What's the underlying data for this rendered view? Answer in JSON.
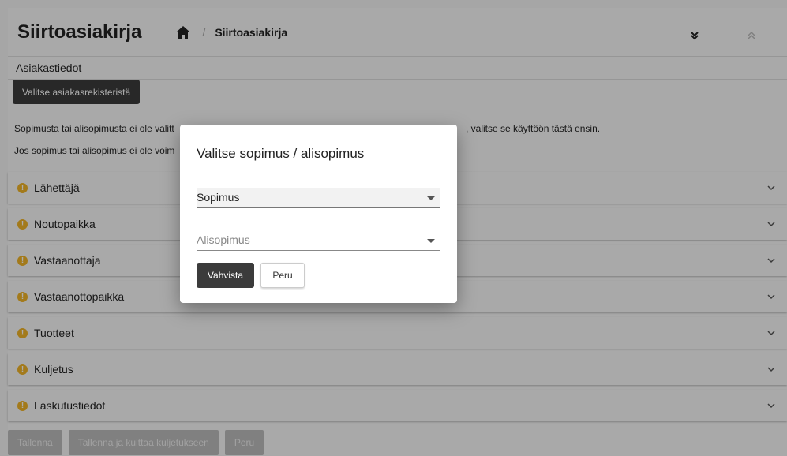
{
  "header": {
    "title": "Siirtoasiakirja",
    "breadcrumb_current": "Siirtoasiakirja",
    "breadcrumb_separator": "/"
  },
  "customer": {
    "section_title": "Asiakastiedot",
    "select_button": "Valitse asiakasrekisteristä",
    "info_line1_start": "Sopimusta tai alisopimusta ei ole valitt",
    "info_line1_end": ", valitse se käyttöön tästä ensin.",
    "info_line2_start": "Jos sopimus tai alisopimus ei ole voim"
  },
  "accordion": [
    {
      "label": "Lähettäjä"
    },
    {
      "label": "Noutopaikka"
    },
    {
      "label": "Vastaanottaja"
    },
    {
      "label": "Vastaanottopaikka"
    },
    {
      "label": "Tuotteet"
    },
    {
      "label": "Kuljetus"
    },
    {
      "label": "Laskutustiedot"
    }
  ],
  "footer": {
    "save": "Tallenna",
    "save_confirm": "Tallenna ja kuittaa kuljetukseen",
    "cancel": "Peru"
  },
  "dialog": {
    "title": "Valitse sopimus / alisopimus",
    "contract_value": "Sopimus",
    "subcontract_placeholder": "Alisopimus",
    "confirm": "Vahvista",
    "cancel": "Peru"
  },
  "colors": {
    "warning": "#f0b429",
    "dark_button": "#3b3b3b"
  }
}
